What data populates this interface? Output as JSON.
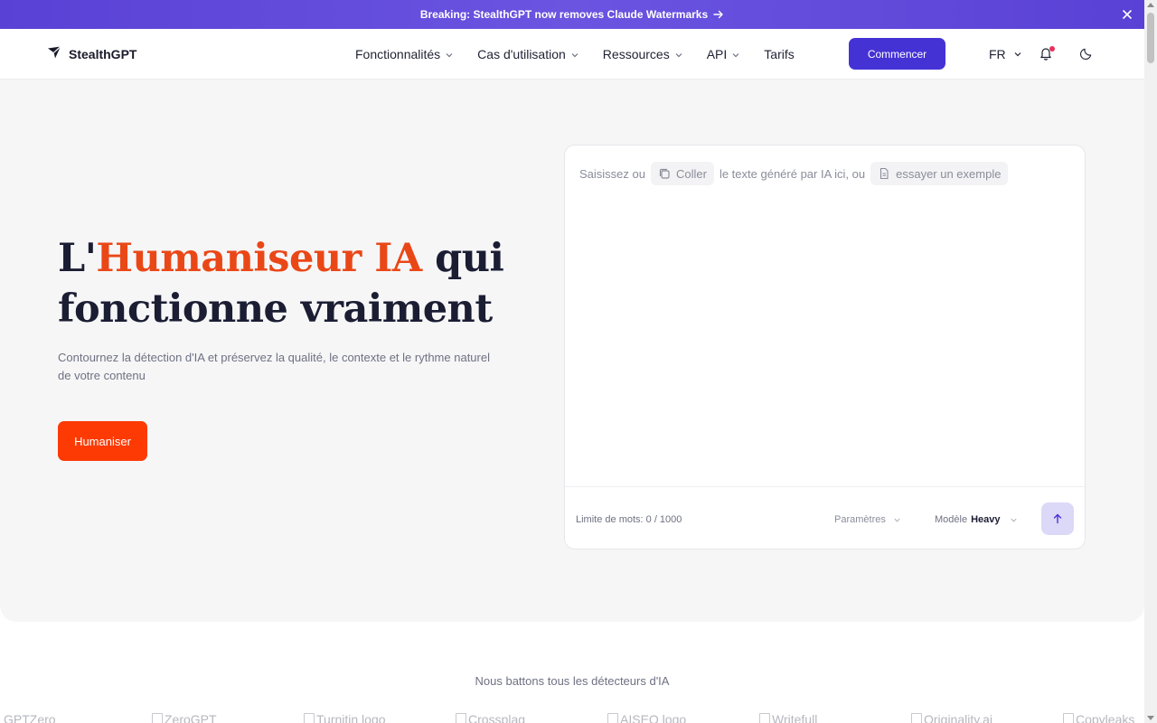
{
  "announcement": {
    "text": "Breaking: StealthGPT now removes Claude Watermarks",
    "arrow_icon": "arrow-right-icon",
    "close_icon": "close-icon"
  },
  "header": {
    "brand": "StealthGPT",
    "nav": [
      {
        "label": "Fonctionnalités",
        "has_dropdown": true
      },
      {
        "label": "Cas d'utilisation",
        "has_dropdown": true
      },
      {
        "label": "Ressources",
        "has_dropdown": true
      },
      {
        "label": "API",
        "has_dropdown": true
      },
      {
        "label": "Tarifs",
        "has_dropdown": false
      }
    ],
    "cta_label": "Commencer",
    "language": "FR"
  },
  "hero": {
    "title_prefix": "L'",
    "title_accent": "Humaniseur IA",
    "title_suffix": " qui fonctionne vraiment",
    "subtitle": "Contournez la détection d'IA et préservez la qualité, le contexte et le rythme naturel de votre contenu",
    "button_label": "Humaniser"
  },
  "editor": {
    "hint_prefix": "Saisissez ou",
    "paste_label": "Coller",
    "hint_middle": "le texte généré par IA ici, ou",
    "example_label": "essayer un exemple",
    "word_limit": "Limite de mots: 0 / 1000",
    "params_label": "Paramètres",
    "model_label": "Modèle",
    "model_value": "Heavy"
  },
  "detectors": {
    "title": "Nous battons tous les détecteurs d'IA",
    "logos": [
      "GPTZero",
      "ZeroGPT",
      "Turnitin logo",
      "Crossplag",
      "AISEO logo",
      "Writefull",
      "Originality.ai",
      "Copyleaks"
    ]
  },
  "colors": {
    "brand_purple": "#4532d5",
    "accent_orange": "#ea4717",
    "button_orange": "#fd3a04"
  }
}
